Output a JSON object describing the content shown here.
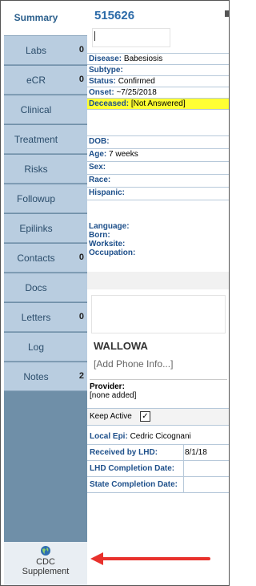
{
  "sidebar": {
    "items": [
      {
        "label": "Summary",
        "count": ""
      },
      {
        "label": "Labs",
        "count": "0"
      },
      {
        "label": "eCR",
        "count": "0"
      },
      {
        "label": "Clinical",
        "count": ""
      },
      {
        "label": "Treatment",
        "count": ""
      },
      {
        "label": "Risks",
        "count": ""
      },
      {
        "label": "Followup",
        "count": ""
      },
      {
        "label": "Epilinks",
        "count": ""
      },
      {
        "label": "Contacts",
        "count": "0"
      },
      {
        "label": "Docs",
        "count": ""
      },
      {
        "label": "Letters",
        "count": "0"
      },
      {
        "label": "Log",
        "count": ""
      },
      {
        "label": "Notes",
        "count": "2"
      }
    ],
    "cdc_supplement": {
      "line1": "CDC",
      "line2": "Supplement",
      "icon": "globe-icon"
    }
  },
  "case": {
    "id": "515626",
    "disease_label": "Disease:",
    "disease_value": "Babesiosis",
    "subtype_label": "Subtype:",
    "subtype_value": "",
    "status_label": "Status:",
    "status_value": "Confirmed",
    "onset_label": "Onset:",
    "onset_value": "~7/25/2018",
    "deceased_label": "Deceased:",
    "deceased_value": "[Not Answered]",
    "dob_label": "DOB:",
    "dob_value": "",
    "age_label": "Age:",
    "age_value": "7 weeks",
    "sex_label": "Sex:",
    "sex_value": "",
    "race_label": "Race:",
    "race_value": "",
    "hispanic_label": "Hispanic:",
    "hispanic_value": "",
    "language_label": "Language:",
    "born_label": "Born:",
    "worksite_label": "Worksite:",
    "occupation_label": "Occupation:",
    "county": "WALLOWA",
    "phone": "[Add Phone Info...]",
    "provider_label": "Provider:",
    "provider_value": "[none added]",
    "keep_active_label": "Keep Active",
    "keep_active_checked": "✓",
    "local_epi_label": "Local Epi:",
    "local_epi_value": "Cedric Cicognani",
    "received_label": "Received by LHD:",
    "received_value": "8/1/18",
    "lhd_completion_label": "LHD Completion Date:",
    "lhd_completion_value": "",
    "state_completion_label": "State Completion Date:",
    "state_completion_value": ""
  },
  "colors": {
    "sidebar_bg": "#6f8fa8",
    "tab_bg": "#b9cde0",
    "accent_blue": "#2b6aa8",
    "deceased_highlight": "#ffff33",
    "arrow_red": "#e8312c"
  }
}
